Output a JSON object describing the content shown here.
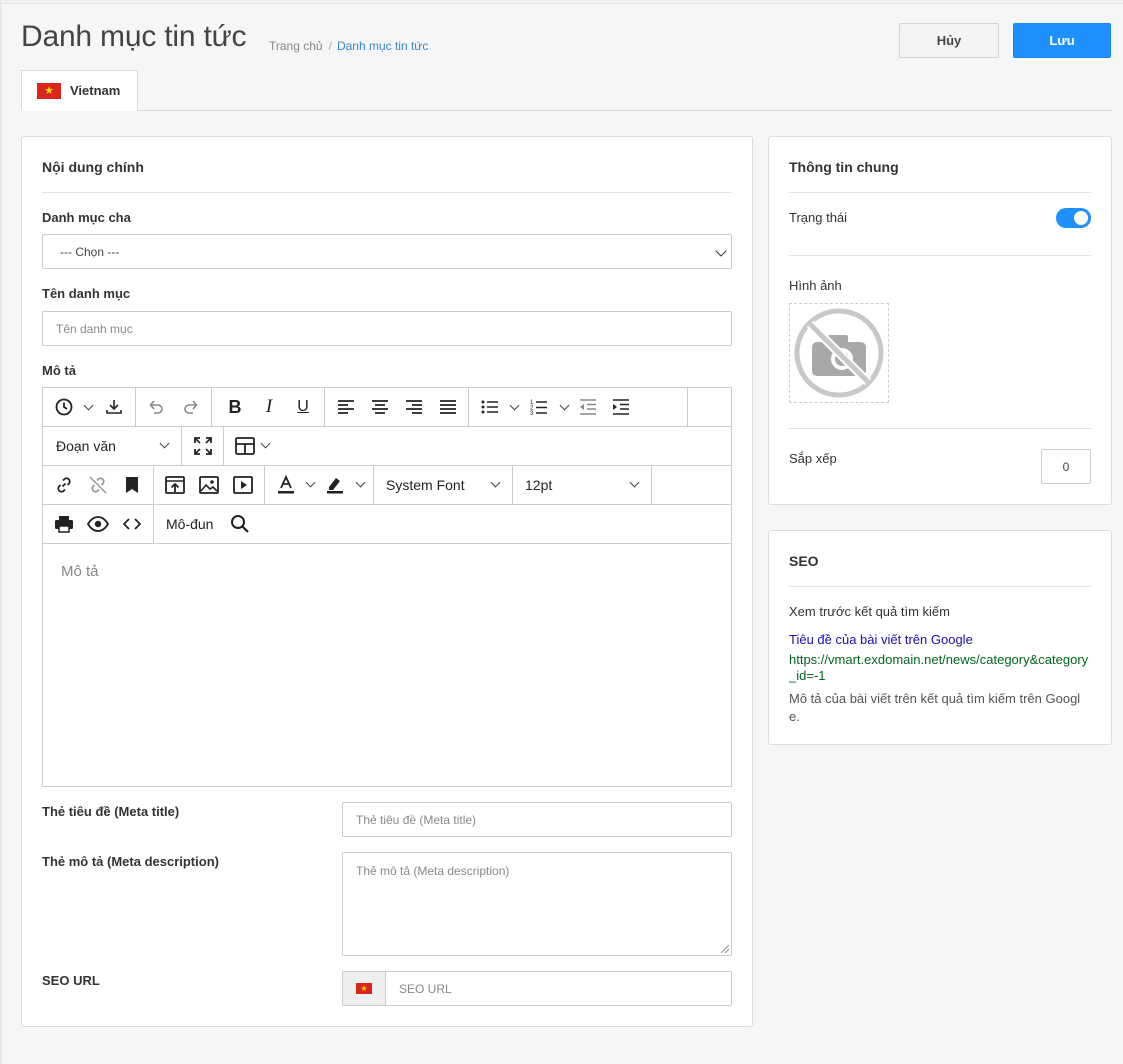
{
  "header": {
    "title": "Danh mục tin tức",
    "breadcrumb": {
      "home": "Trang chủ",
      "current": "Danh mục tin tức"
    },
    "cancel_label": "Hủy",
    "save_label": "Lưu"
  },
  "tabs": [
    {
      "label": "Vietnam",
      "flag": "vietnam-flag-icon"
    }
  ],
  "main": {
    "title": "Nội dung chính",
    "parent_label": "Danh mục cha",
    "parent_value": "--- Chọn ---",
    "name_label": "Tên danh mục",
    "name_placeholder": "Tên danh mục",
    "desc_label": "Mô tả",
    "editor": {
      "block_format": "Đoạn văn",
      "font_family": "System Font",
      "font_size": "12pt",
      "module_label": "Mô-đun",
      "placeholder": "Mô tả",
      "icons": [
        "history-icon",
        "download-icon",
        "undo-icon",
        "redo-icon",
        "bold-icon",
        "italic-icon",
        "underline-icon",
        "align-left-icon",
        "align-center-icon",
        "align-right-icon",
        "align-justify-icon",
        "bullet-list-icon",
        "numbered-list-icon",
        "outdent-icon",
        "indent-icon",
        "fullscreen-icon",
        "table-icon",
        "link-icon",
        "unlink-icon",
        "bookmark-icon",
        "upload-icon",
        "image-icon",
        "media-icon",
        "text-color-icon",
        "highlight-icon",
        "print-icon",
        "preview-icon",
        "code-icon",
        "search-icon"
      ]
    },
    "meta_title_label": "Thẻ tiêu đề (Meta title)",
    "meta_title_placeholder": "Thẻ tiêu đề (Meta title)",
    "meta_desc_label": "Thẻ mô tả (Meta description)",
    "meta_desc_placeholder": "Thẻ mô tả (Meta description)",
    "seo_url_label": "SEO URL",
    "seo_url_placeholder": "SEO URL"
  },
  "general": {
    "title": "Thông tin chung",
    "status_label": "Trạng thái",
    "status_on": true,
    "image_label": "Hình ảnh",
    "sort_label": "Sắp xếp",
    "sort_value": "0"
  },
  "seo": {
    "title": "SEO",
    "preview_label": "Xem trước kết quả tìm kiếm",
    "preview_title": "Tiêu đề của bài viết trên Google",
    "preview_url": "https://vmart.exdomain.net/news/category&category_id=-1",
    "preview_desc": "Mô tả của bài viết trên kết quả tìm kiếm trên Google."
  },
  "colors": {
    "primary": "#1e90ff",
    "serp_title": "#1a0dab",
    "serp_url": "#006621"
  }
}
